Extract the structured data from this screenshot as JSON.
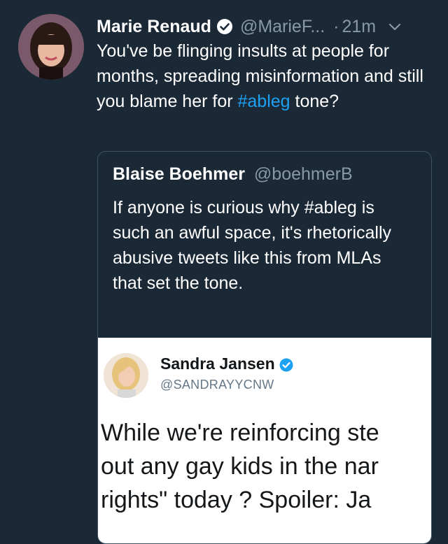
{
  "tweet": {
    "author_name": "Marie Renaud",
    "author_handle": "@MarieF...",
    "separator": "·",
    "time": "21m",
    "verified_icon": "verified-badge-icon",
    "menu_icon": "chevron-down-icon",
    "text_before": "You've be flinging insults at people for months, spreading misinformation and still you blame her for ",
    "hashtag": "#ableg",
    "text_after": " tone?"
  },
  "quoted_tweet": {
    "author_name": "Blaise Boehmer",
    "author_handle": "@boehmerB",
    "text": "If anyone is curious why #ableg is such an awful space, it's rhetorically abusive tweets like this from MLAs that set the tone."
  },
  "embedded_screenshot": {
    "author_name": "Sandra Jansen",
    "author_handle": "@SANDRAYYCNW",
    "verified_icon": "verified-badge-icon",
    "lines": [
      "While we're reinforcing ste",
      "out any gay kids in the nar",
      "rights\" today ? Spoiler: Ja"
    ]
  },
  "colors": {
    "background": "#1b2836",
    "link": "#1da1f2",
    "muted": "#8899a6",
    "verified": "#1da1f2"
  }
}
